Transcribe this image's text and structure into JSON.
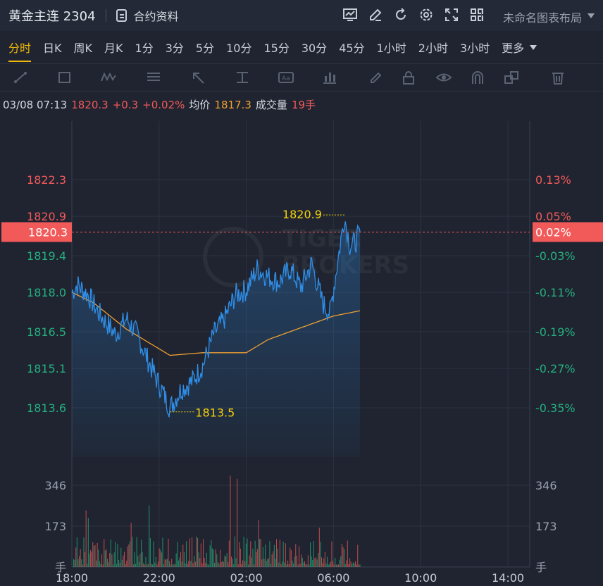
{
  "header": {
    "title": "黄金主连 2304",
    "info_link": "合约资料",
    "layout_label": "未命名图表布局"
  },
  "tabs": [
    "分时",
    "日K",
    "周K",
    "月K",
    "1分",
    "3分",
    "5分",
    "10分",
    "15分",
    "30分",
    "45分",
    "1小时",
    "2小时",
    "3小时",
    "更多"
  ],
  "active_tab": "分时",
  "info": {
    "datetime": "03/08 07:13",
    "price": "1820.3",
    "change": "+0.3",
    "change_pct": "+0.02%",
    "avg_label": "均价",
    "avg_value": "1817.3",
    "volume_label": "成交量",
    "volume_value": "19手"
  },
  "watermark": {
    "line1": "TIGER",
    "line2": "BROKERS"
  },
  "colors": {
    "up": "#f25a5a",
    "down": "#26b07e",
    "price_line": "#2f8ee8",
    "avg_line": "#f0a030",
    "marker": "#f5d30a"
  },
  "chart_data": {
    "type": "line",
    "price_ticks": [
      "1822.3",
      "1820.9",
      "1819.4",
      "1818.0",
      "1816.5",
      "1815.1",
      "1813.6"
    ],
    "pct_ticks": [
      "0.13%",
      "0.05%",
      "-0.03%",
      "-0.11%",
      "-0.19%",
      "-0.27%",
      "-0.35%"
    ],
    "current_price": "1820.3",
    "current_pct": "0.02%",
    "high_marker": "1820.9",
    "low_marker": "1813.5",
    "volume_ticks": [
      "346",
      "173"
    ],
    "volume_unit": "手",
    "x_ticks": [
      "18:00",
      "22:00",
      "02:00",
      "06:00",
      "10:00",
      "14:00"
    ],
    "price_series_keypoints": [
      [
        "18:00",
        1818.0
      ],
      [
        "18:15",
        1818.3
      ],
      [
        "18:45",
        1817.9
      ],
      [
        "19:15",
        1817.2
      ],
      [
        "20:00",
        1816.4
      ],
      [
        "20:30",
        1817.0
      ],
      [
        "21:00",
        1816.4
      ],
      [
        "21:30",
        1815.4
      ],
      [
        "22:00",
        1814.5
      ],
      [
        "22:30",
        1813.6
      ],
      [
        "23:00",
        1814.3
      ],
      [
        "23:30",
        1814.6
      ],
      [
        "00:00",
        1815.2
      ],
      [
        "00:30",
        1816.4
      ],
      [
        "01:00",
        1817.0
      ],
      [
        "01:30",
        1817.9
      ],
      [
        "02:00",
        1818.1
      ],
      [
        "02:30",
        1818.9
      ],
      [
        "03:00",
        1818.6
      ],
      [
        "03:30",
        1818.4
      ],
      [
        "04:00",
        1818.9
      ],
      [
        "04:30",
        1818.2
      ],
      [
        "05:00",
        1819.1
      ],
      [
        "05:30",
        1817.6
      ],
      [
        "05:50",
        1817.2
      ],
      [
        "06:15",
        1819.5
      ],
      [
        "06:30",
        1820.9
      ],
      [
        "06:45",
        1819.8
      ],
      [
        "07:00",
        1819.9
      ],
      [
        "07:13",
        1820.3
      ]
    ],
    "avg_series_keypoints": [
      [
        "18:00",
        1818.0
      ],
      [
        "19:00",
        1817.6
      ],
      [
        "20:30",
        1816.6
      ],
      [
        "21:30",
        1816.1
      ],
      [
        "22:30",
        1815.6
      ],
      [
        "00:00",
        1815.7
      ],
      [
        "01:00",
        1815.7
      ],
      [
        "02:00",
        1815.7
      ],
      [
        "03:00",
        1816.2
      ],
      [
        "04:00",
        1816.5
      ],
      [
        "05:00",
        1816.8
      ],
      [
        "06:00",
        1817.1
      ],
      [
        "07:13",
        1817.3
      ]
    ]
  }
}
